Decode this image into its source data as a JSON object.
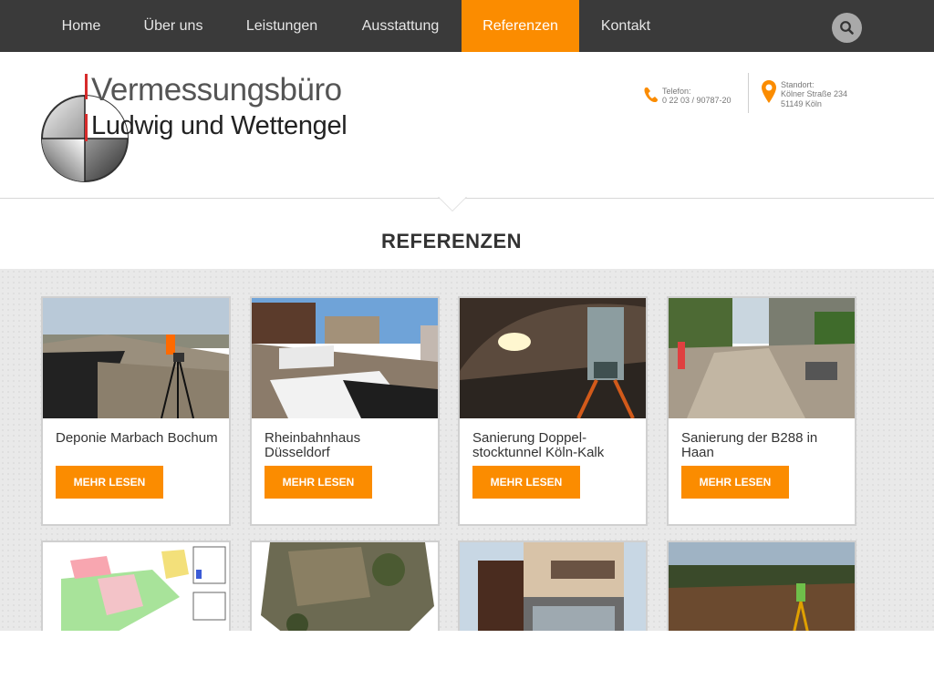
{
  "nav": {
    "items": [
      "Home",
      "Über uns",
      "Leistungen",
      "Ausstattung",
      "Referenzen",
      "Kontakt"
    ],
    "active_index": 4
  },
  "logo": {
    "line1": "Vermessungsbüro",
    "line2": "Ludwig und Wettengel"
  },
  "contact": {
    "phone_label": "Telefon:",
    "phone": "0 22 03 / 90787-20",
    "location_label": "Standort:",
    "street": "Kölner Straße 234",
    "city": "51149 Köln"
  },
  "section": {
    "title": "REFERENZEN"
  },
  "cards": [
    {
      "title": "Deponie Marbach Bochum",
      "button": "MEHR LESEN"
    },
    {
      "title": "Rheinbahnhaus Düsseldorf",
      "button": "MEHR LESEN"
    },
    {
      "title": "Sanierung Doppel-stocktunnel Köln-Kalk",
      "button": "MEHR LESEN"
    },
    {
      "title": "Sanierung der B288 in Haan",
      "button": "MEHR LESEN"
    }
  ],
  "colors": {
    "accent": "#fb8c00",
    "nav_bg": "#3a3a3a"
  }
}
